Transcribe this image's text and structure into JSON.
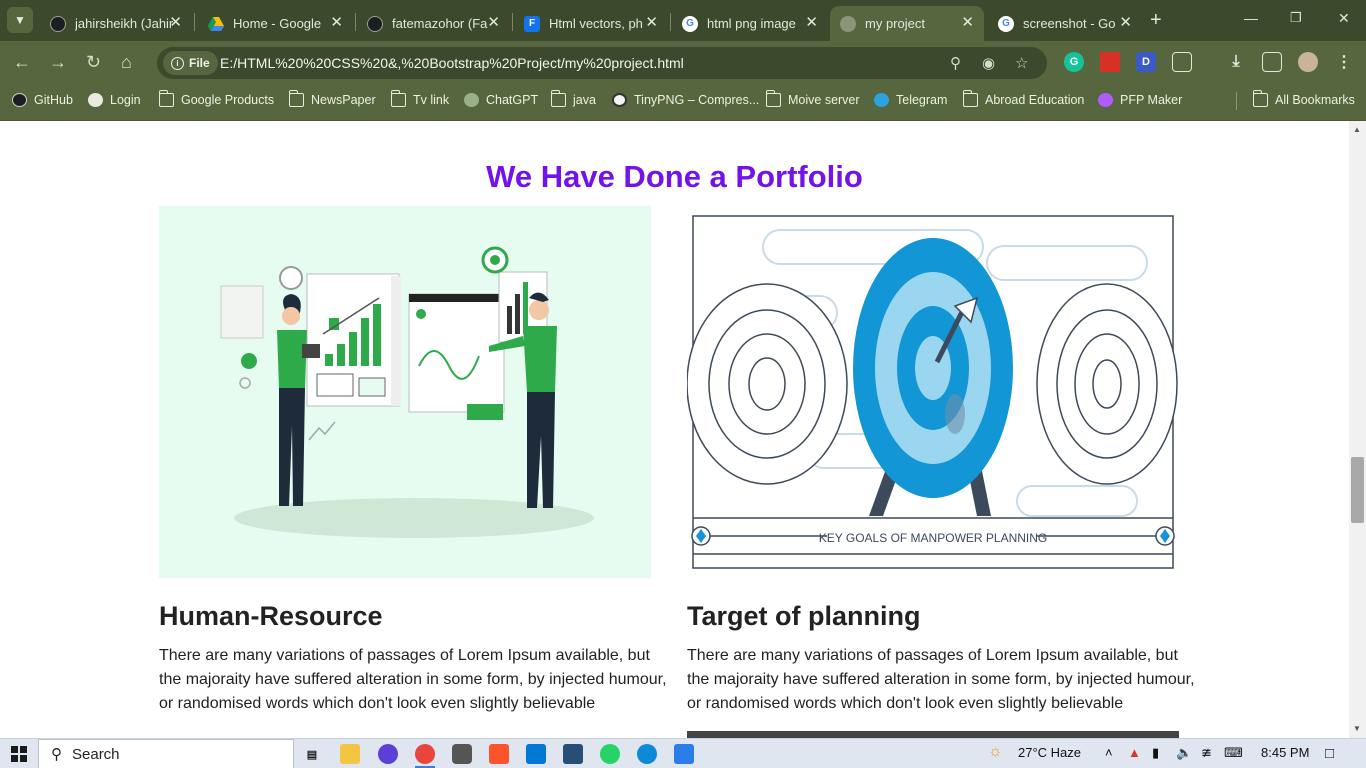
{
  "browser": {
    "tabs": [
      {
        "title": "jahirsheikh (Jahir",
        "favicon": "github-icon",
        "color": "#1b1f23"
      },
      {
        "title": "Home - Google",
        "favicon": "drive-icon",
        "color": "#fbbc04"
      },
      {
        "title": "fatemazohor (Fa",
        "favicon": "github-icon",
        "color": "#1b1f23"
      },
      {
        "title": "Html vectors, ph",
        "favicon": "freepik-icon",
        "color": "#1273eb"
      },
      {
        "title": "html png image",
        "favicon": "google-icon",
        "color": "#4285f4"
      },
      {
        "title": "my project",
        "favicon": "globe-icon",
        "color": "#8a9478",
        "active": true
      },
      {
        "title": "screenshot - Go",
        "favicon": "google-icon",
        "color": "#4285f4"
      }
    ],
    "new_tab": "+",
    "address": {
      "scheme_label": "File",
      "url": "E:/HTML%20%20CSS%20&,%20Bootstrap%20Project/my%20project.html"
    },
    "bookmarks": [
      {
        "label": "GitHub",
        "icon": "github-icon"
      },
      {
        "label": "Login",
        "icon": "globe-icon"
      },
      {
        "label": "Google Products",
        "icon": "folder-icon"
      },
      {
        "label": "NewsPaper",
        "icon": "folder-icon"
      },
      {
        "label": "Tv link",
        "icon": "folder-icon"
      },
      {
        "label": "ChatGPT",
        "icon": "chatgpt-icon"
      },
      {
        "label": "java",
        "icon": "folder-icon"
      },
      {
        "label": "TinyPNG – Compres...",
        "icon": "panda-icon"
      },
      {
        "label": "Moive server",
        "icon": "folder-icon"
      },
      {
        "label": "Telegram",
        "icon": "telegram-icon"
      },
      {
        "label": "Abroad Education",
        "icon": "folder-icon"
      },
      {
        "label": "PFP Maker",
        "icon": "pfp-icon"
      }
    ],
    "all_bookmarks": "All Bookmarks"
  },
  "page": {
    "section_title": "We Have Done a Portfolio",
    "cards": [
      {
        "title": "Human-Resource",
        "text": "There are many variations of passages of Lorem Ipsum available, but the majoraity have suffered alteration in some form, by injected humour, or randomised words which don't look even slightly believable"
      },
      {
        "title": "Target of planning",
        "text": "There are many variations of passages of Lorem Ipsum available, but the majoraity have suffered alteration in some form, by injected humour, or randomised words which don't look even slightly believable",
        "banner_label": "KEY GOALS OF MANPOWER PLANNING"
      }
    ],
    "accent_color": "#7412ea"
  },
  "taskbar": {
    "search_label": "Search",
    "weather": "27°C  Haze",
    "time": "8:45 PM"
  }
}
